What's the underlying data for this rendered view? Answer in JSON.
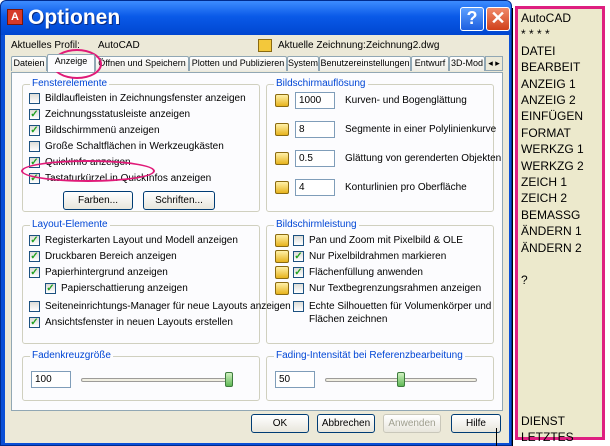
{
  "window": {
    "title": "Optionen",
    "help_glyph": "?",
    "close_glyph": "✕",
    "title_icon_glyph": "A"
  },
  "header": {
    "profile_label": "Aktuelles Profil:",
    "profile_value": "AutoCAD",
    "drawing_label": "Aktuelle Zeichnung:",
    "drawing_value": "Zeichnung2.dwg"
  },
  "tabs": [
    {
      "label": "Dateien",
      "active": false
    },
    {
      "label": "Anzeige",
      "active": true
    },
    {
      "label": "Öffnen und Speichern",
      "active": false
    },
    {
      "label": "Plotten und Publizieren",
      "active": false
    },
    {
      "label": "System",
      "active": false
    },
    {
      "label": "Benutzereinstellungen",
      "active": false
    },
    {
      "label": "Entwurf",
      "active": false
    },
    {
      "label": "3D-Mod",
      "active": false
    }
  ],
  "tab_scroll": "◂ ▸",
  "fensterelemente": {
    "title": "Fensterelemente",
    "items": [
      {
        "label": "Bildlaufleisten in Zeichnungsfenster anzeigen",
        "checked": false
      },
      {
        "label": "Zeichnungsstatusleiste anzeigen",
        "checked": true
      },
      {
        "label": "Bildschirmmenü anzeigen",
        "checked": true
      },
      {
        "label": "Große Schaltflächen in Werkzeugkästen",
        "checked": false
      },
      {
        "label": "QuickInfo anzeigen",
        "checked": true
      },
      {
        "label": "Tastaturkürzel in QuickInfos anzeigen",
        "checked": true
      }
    ],
    "farben_button": "Farben...",
    "schriften_button": "Schriften..."
  },
  "bildschirmaufloesung": {
    "title": "Bildschirmauflösung",
    "items": [
      {
        "value": "1000",
        "label": "Kurven- und Bogenglättung"
      },
      {
        "value": "8",
        "label": "Segmente in einer Polylinienkurve"
      },
      {
        "value": "0.5",
        "label": "Glättung von gerenderten Objekten"
      },
      {
        "value": "4",
        "label": "Konturlinien pro Oberfläche"
      }
    ]
  },
  "layout_elemente": {
    "title": "Layout-Elemente",
    "items": [
      {
        "label": "Registerkarten Layout und Modell anzeigen",
        "checked": true
      },
      {
        "label": "Druckbaren Bereich anzeigen",
        "checked": true
      },
      {
        "label": "Papierhintergrund anzeigen",
        "checked": true
      },
      {
        "label": "Papierschattierung anzeigen",
        "checked": true
      },
      {
        "label": "Seiteneinrichtungs-Manager für neue Layouts anzeigen",
        "checked": false
      },
      {
        "label": "Ansichtsfenster in neuen Layouts erstellen",
        "checked": true
      }
    ]
  },
  "bildschirmleistung": {
    "title": "Bildschirmleistung",
    "items": [
      {
        "label": "Pan und Zoom mit Pixelbild & OLE",
        "checked": false
      },
      {
        "label": "Nur Pixelbildrahmen markieren",
        "checked": true
      },
      {
        "label": "Flächenfüllung anwenden",
        "checked": true
      },
      {
        "label": "Nur Textbegrenzungsrahmen anzeigen",
        "checked": false
      },
      {
        "label": "Echte Silhouetten für Volumenkörper und",
        "label2": "Flächen zeichnen",
        "checked": false
      }
    ]
  },
  "fadenkreuz": {
    "title": "Fadenkreuzgröße",
    "value": "100",
    "level": 1.0
  },
  "fading": {
    "title": "Fading-Intensität bei Referenzbearbeitung",
    "value": "50",
    "level": 0.5
  },
  "buttons": {
    "ok": "OK",
    "cancel": "Abbrechen",
    "apply": "Anwenden",
    "help": "Hilfe"
  },
  "screen_menu": {
    "items": [
      "AutoCAD",
      "* * * *",
      "DATEI",
      "BEARBEIT",
      "ANZEIG 1",
      "ANZEIG 2",
      "EINFÜGEN",
      "FORMAT",
      "WERKZG 1",
      "WERKZG 2",
      "ZEICH 1",
      "ZEICH 2",
      "BEMASSG",
      "ÄNDERN 1",
      "ÄNDERN 2",
      "",
      "?"
    ],
    "bottom_items": [
      "DIENST",
      "LETZTES"
    ]
  },
  "colors": {
    "accent": "#0a4fd6",
    "highlight": "#e01a78",
    "group_title": "#0046d5"
  }
}
